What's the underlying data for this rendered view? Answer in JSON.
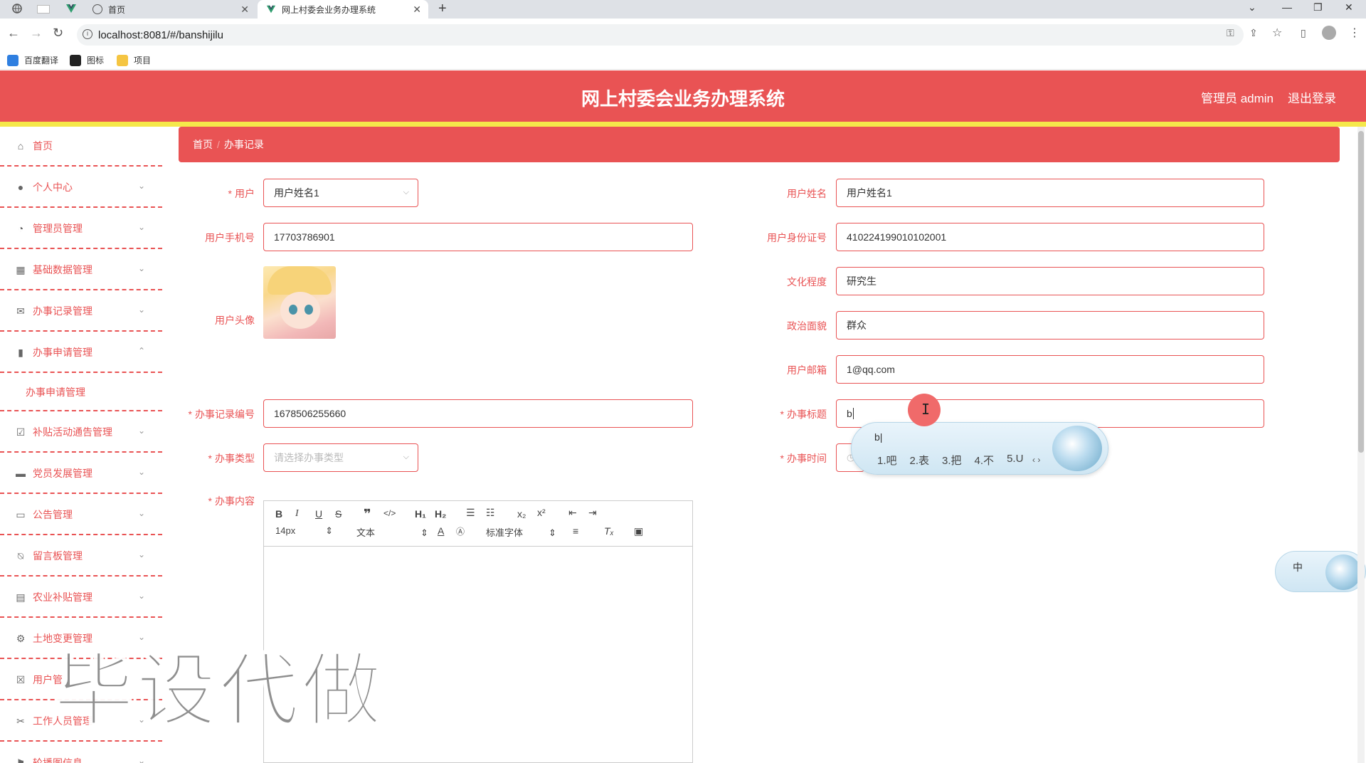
{
  "browser": {
    "tabs": [
      {
        "label": "首页"
      },
      {
        "label": "网上村委会业务办理系统"
      }
    ],
    "url": "localhost:8081/#/banshijilu",
    "bookmarks": [
      {
        "label": "百度翻译"
      },
      {
        "label": "图标"
      },
      {
        "label": "项目"
      }
    ]
  },
  "header": {
    "title": "网上村委会业务办理系统",
    "admin": "管理员 admin",
    "logout": "退出登录"
  },
  "sidebar": {
    "items": [
      {
        "label": "首页",
        "icon": "home-icon"
      },
      {
        "label": "个人中心",
        "icon": "user-icon"
      },
      {
        "label": "管理员管理",
        "icon": "dashboard-icon"
      },
      {
        "label": "基础数据管理",
        "icon": "grid-icon"
      },
      {
        "label": "办事记录管理",
        "icon": "mail-icon"
      },
      {
        "label": "办事申请管理",
        "icon": "mic-icon"
      },
      {
        "label": "办事申请管理",
        "icon": "none"
      },
      {
        "label": "补贴活动通告管理",
        "icon": "clipboard-check-icon"
      },
      {
        "label": "党员发展管理",
        "icon": "monitor-icon"
      },
      {
        "label": "公告管理",
        "icon": "chat-icon"
      },
      {
        "label": "留言板管理",
        "icon": "bell-off-icon"
      },
      {
        "label": "农业补贴管理",
        "icon": "document-icon"
      },
      {
        "label": "土地变更管理",
        "icon": "settings-icon"
      },
      {
        "label": "用户管",
        "icon": "clipboard-x-icon"
      },
      {
        "label": "工作人员管理",
        "icon": "film-icon"
      },
      {
        "label": "轮播图信息",
        "icon": "flag-icon"
      }
    ]
  },
  "breadcrumb": {
    "home": "首页",
    "current": "办事记录"
  },
  "form": {
    "user_label": "用户",
    "user_value": "用户姓名1",
    "user_name_label": "用户姓名",
    "user_name_value": "用户姓名1",
    "phone_label": "用户手机号",
    "phone_value": "17703786901",
    "id_label": "用户身份证号",
    "id_value": "410224199010102001",
    "avatar_label": "用户头像",
    "education_label": "文化程度",
    "education_value": "研究生",
    "politics_label": "政治面貌",
    "politics_value": "群众",
    "email_label": "用户邮箱",
    "email_value": "1@qq.com",
    "record_no_label": "办事记录编号",
    "record_no_value": "1678506255660",
    "title_label": "办事标题",
    "title_value": "b",
    "type_label": "办事类型",
    "type_placeholder": "请选择办事类型",
    "time_label": "办事时间",
    "content_label": "办事内容"
  },
  "editor": {
    "font_size": "14px",
    "paragraph": "文本",
    "font_family": "标准字体"
  },
  "ime": {
    "composition": "b",
    "candidates": [
      "1.吧",
      "2.表",
      "3.把",
      "4.不",
      "5.U"
    ],
    "mode": "中"
  },
  "watermark": "毕设代做"
}
